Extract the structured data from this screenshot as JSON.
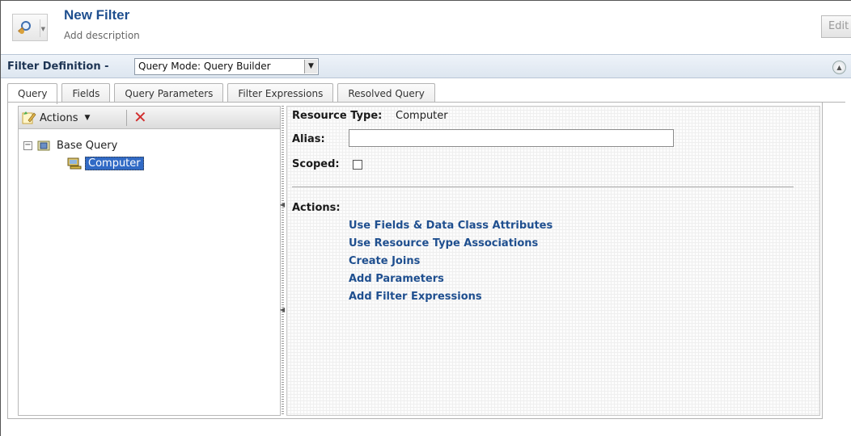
{
  "header": {
    "title": "New Filter",
    "description": "Add description",
    "edit_label": "Edit",
    "icon": "filter-magnifier-icon"
  },
  "definition_bar": {
    "label": "Filter Definition -",
    "query_mode_selected": "Query Mode: Query Builder",
    "collapse_icon": "collapse-up-icon"
  },
  "tabs": [
    {
      "label": "Query",
      "active": true
    },
    {
      "label": "Fields",
      "active": false
    },
    {
      "label": "Query Parameters",
      "active": false
    },
    {
      "label": "Filter Expressions",
      "active": false
    },
    {
      "label": "Resolved Query",
      "active": false
    }
  ],
  "left_pane": {
    "toolbar": {
      "actions_label": "Actions",
      "delete_icon": "delete-x-icon"
    },
    "tree": {
      "root": {
        "label": "Base Query",
        "expanded": true,
        "toggle": "−"
      },
      "child": {
        "label": "Computer",
        "selected": true
      }
    }
  },
  "right_pane": {
    "resource_type_label": "Resource Type:",
    "resource_type_value": "Computer",
    "alias_label": "Alias:",
    "alias_value": "",
    "scoped_label": "Scoped:",
    "scoped_checked": false,
    "actions_label": "Actions:",
    "actions": [
      "Use Fields & Data Class Attributes",
      "Use Resource Type Associations",
      "Create Joins",
      "Add Parameters",
      "Add Filter Expressions"
    ]
  },
  "colors": {
    "title_blue": "#1f4f8f",
    "link_blue": "#1f4f8f",
    "selection_blue": "#316ac5",
    "delete_red": "#d23030"
  }
}
